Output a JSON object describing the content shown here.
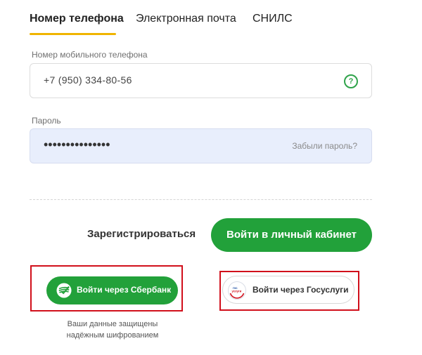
{
  "tabs": [
    {
      "label": "Номер телефона",
      "active": true
    },
    {
      "label": "Электронная почта",
      "active": false
    },
    {
      "label": "СНИЛС",
      "active": false
    }
  ],
  "phone": {
    "label": "Номер мобильного телефона",
    "value": "+7 (950) 334-80-56",
    "help_icon": "question-circle-icon"
  },
  "password": {
    "label": "Пароль",
    "value": "•••••••••••••••",
    "forgot_label": "Забыли пароль?"
  },
  "actions": {
    "register_label": "Зарегистрироваться",
    "login_label": "Войти в личный кабинет"
  },
  "alt_login": {
    "sber_label": "Войти через Сбербанк",
    "gos_label": "Войти через Госуслуги",
    "gos_logo_text_1": "гос",
    "gos_logo_text_2": "услуги",
    "secure_note_line1": "Ваши данные защищены",
    "secure_note_line2": "надёжным шифрованием"
  },
  "colors": {
    "accent_green": "#22a13a",
    "tab_underline": "#f0b400",
    "highlight_frame": "#d10f1b"
  }
}
